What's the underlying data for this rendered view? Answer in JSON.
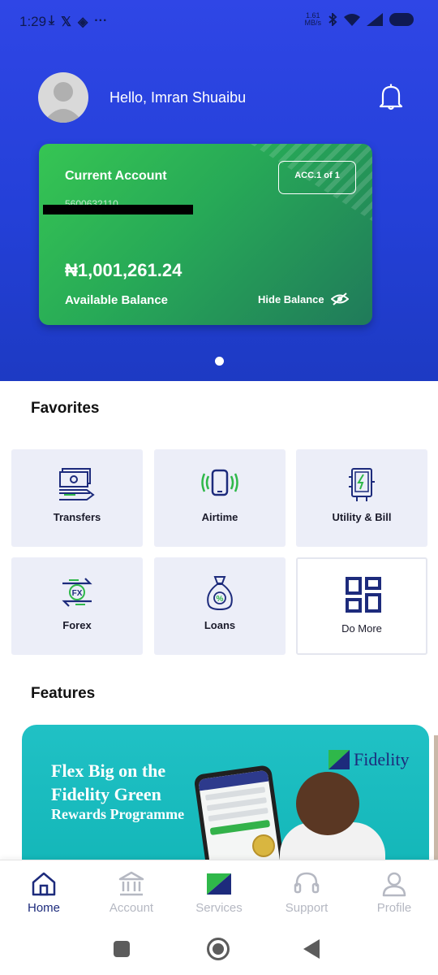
{
  "status_bar": {
    "time": "1:29",
    "left_icons": [
      "download-icon",
      "x-icon",
      "binance-icon",
      "more-icon"
    ],
    "net_speed_value": "1.61",
    "net_speed_unit": "MB/s",
    "right_icons": [
      "bluetooth-icon",
      "wifi-icon",
      "signal-icon",
      "battery-icon"
    ]
  },
  "header": {
    "greeting": "Hello, Imran Shuaibu"
  },
  "account_card": {
    "title": "Current Account",
    "badge": "ACC.1 of 1",
    "account_number": "5600632110",
    "balance": "₦1,001,261.24",
    "balance_label": "Available Balance",
    "hide_balance_label": "Hide Balance",
    "pager_pages": 1,
    "pager_current": 1
  },
  "favorites": {
    "title": "Favorites",
    "items": [
      {
        "label": "Transfers",
        "icon": "transfer-money-icon"
      },
      {
        "label": "Airtime",
        "icon": "phone-icon"
      },
      {
        "label": "Utility & Bill",
        "icon": "utility-meter-icon"
      },
      {
        "label": "Forex",
        "icon": "fx-exchange-icon"
      },
      {
        "label": "Loans",
        "icon": "money-bag-icon"
      },
      {
        "label": "Do More",
        "icon": "grid-icon"
      }
    ]
  },
  "features": {
    "title": "Features",
    "banner": {
      "line1": "Flex Big on the",
      "line2": "Fidelity Green",
      "line3": "Rewards Programme",
      "brand": "Fidelity"
    }
  },
  "bottom_nav": {
    "items": [
      {
        "label": "Home",
        "icon": "home-icon",
        "active": true
      },
      {
        "label": "Account",
        "icon": "bank-icon",
        "active": false
      },
      {
        "label": "Services",
        "icon": "fidelity-logo-icon",
        "active": false
      },
      {
        "label": "Support",
        "icon": "headset-icon",
        "active": false
      },
      {
        "label": "Profile",
        "icon": "person-icon",
        "active": false
      }
    ]
  },
  "colors": {
    "header_blue": "#2f46e6",
    "card_green": "#36c553",
    "brand_navy": "#1d2b7c",
    "tile_bg": "#eceef8"
  }
}
